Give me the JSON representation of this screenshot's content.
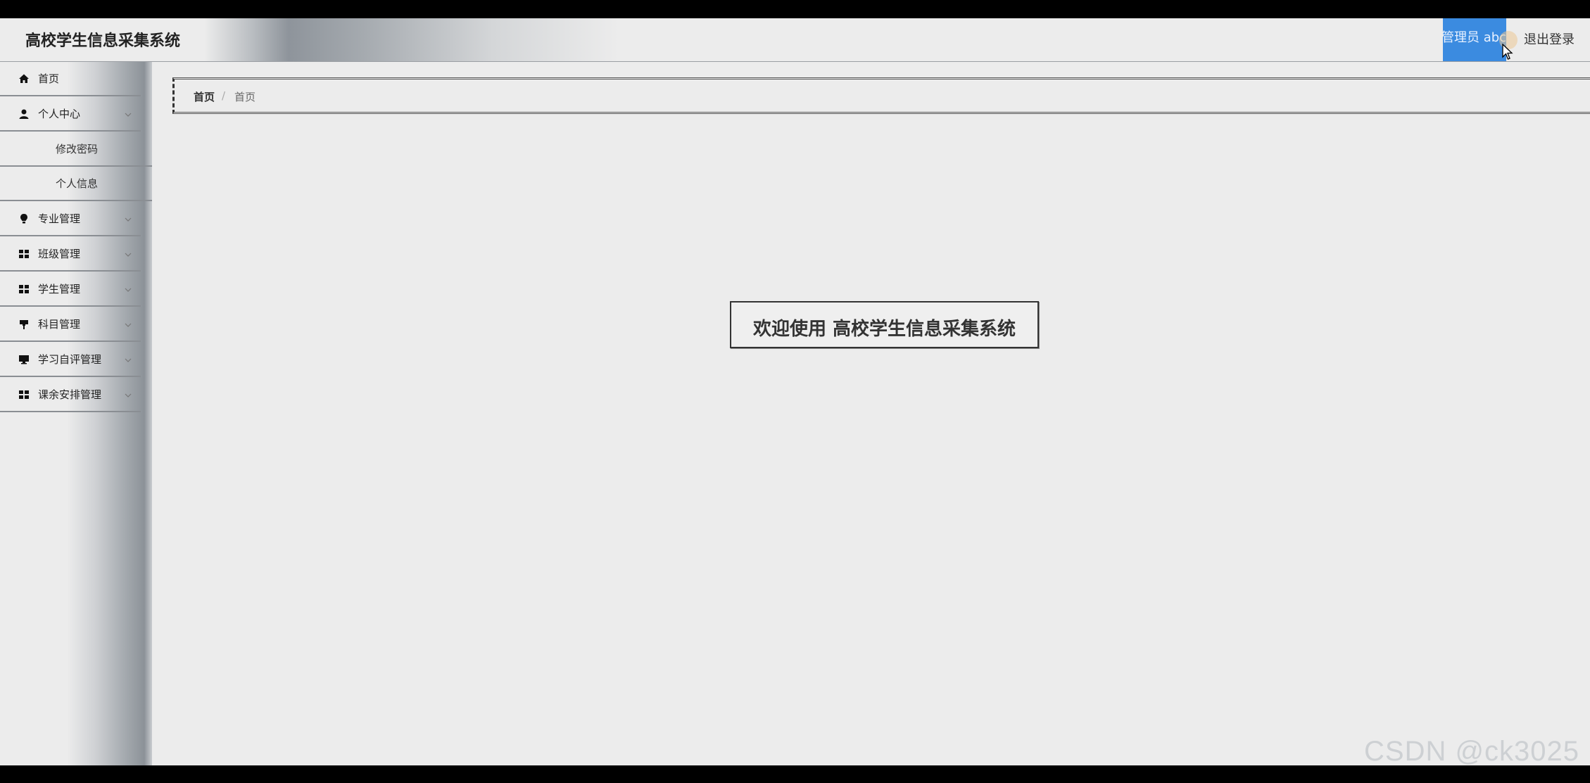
{
  "header": {
    "title": "高校学生信息采集系统",
    "user_label": "管理员 abc",
    "logout_label": "退出登录"
  },
  "sidebar": {
    "items": [
      {
        "label": "首页",
        "icon": "home-icon",
        "expandable": false
      },
      {
        "label": "个人中心",
        "icon": "user-icon",
        "expandable": true
      },
      {
        "label": "修改密码",
        "sub": true
      },
      {
        "label": "个人信息",
        "sub": true
      },
      {
        "label": "专业管理",
        "icon": "bulb-icon",
        "expandable": true
      },
      {
        "label": "班级管理",
        "icon": "grid-icon",
        "expandable": true
      },
      {
        "label": "学生管理",
        "icon": "grid-icon",
        "expandable": true
      },
      {
        "label": "科目管理",
        "icon": "flag-icon",
        "expandable": true
      },
      {
        "label": "学习自评管理",
        "icon": "monitor-icon",
        "expandable": true
      },
      {
        "label": "课余安排管理",
        "icon": "grid-icon",
        "expandable": true
      }
    ]
  },
  "breadcrumb": {
    "home": "首页",
    "separator": "/",
    "current": "首页"
  },
  "main": {
    "welcome": "欢迎使用 高校学生信息采集系统"
  },
  "watermark": "CSDN @ck3025",
  "colors": {
    "accent": "#3b8be0",
    "background": "#ececec"
  }
}
